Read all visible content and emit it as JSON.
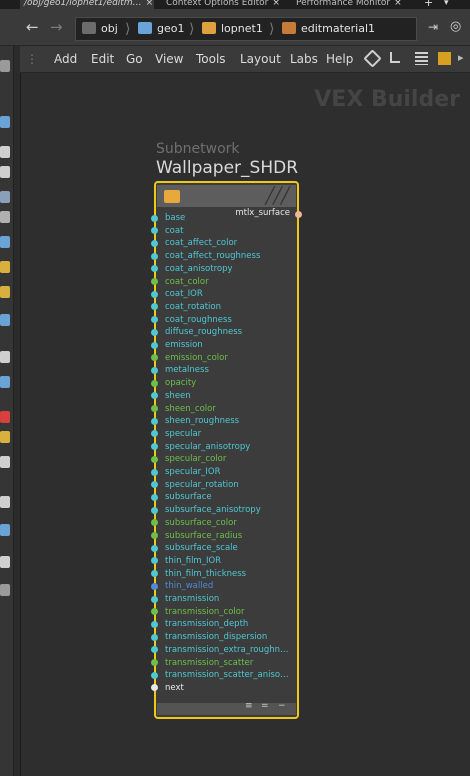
{
  "tabs": [
    {
      "label": "/obj/geo1/lopnet1/editm…",
      "active": true
    },
    {
      "label": "Context Options Editor",
      "active": false
    },
    {
      "label": "Performance Monitor",
      "active": false
    }
  ],
  "path": {
    "crumbs": [
      {
        "label": "obj",
        "color": "#555555"
      },
      {
        "label": "geo1",
        "color": "#6aa3d8"
      },
      {
        "label": "lopnet1",
        "color": "#e0a040"
      },
      {
        "label": "editmaterial1",
        "color": "#c77b3a"
      }
    ]
  },
  "menu": [
    "Add",
    "Edit",
    "Go",
    "View",
    "Tools",
    "Layout",
    "Labs",
    "Help"
  ],
  "context_label": "VEX Builder",
  "node": {
    "type": "Subnetwork",
    "name": "Wallpaper_SHDR",
    "output": "mtlx_surface",
    "output_color": "#f0b59a",
    "inputs": [
      {
        "label": "base",
        "color": "#4fc8d2"
      },
      {
        "label": "coat",
        "color": "#4fc8d2"
      },
      {
        "label": "coat_affect_color",
        "color": "#4fc8d2"
      },
      {
        "label": "coat_affect_roughness",
        "color": "#4fc8d2"
      },
      {
        "label": "coat_anisotropy",
        "color": "#4fc8d2"
      },
      {
        "label": "coat_color",
        "color": "#6dbf4a"
      },
      {
        "label": "coat_IOR",
        "color": "#4fc8d2"
      },
      {
        "label": "coat_rotation",
        "color": "#4fc8d2"
      },
      {
        "label": "coat_roughness",
        "color": "#4fc8d2"
      },
      {
        "label": "diffuse_roughness",
        "color": "#4fc8d2"
      },
      {
        "label": "emission",
        "color": "#4fc8d2"
      },
      {
        "label": "emission_color",
        "color": "#6dbf4a"
      },
      {
        "label": "metalness",
        "color": "#4fc8d2"
      },
      {
        "label": "opacity",
        "color": "#6dbf4a"
      },
      {
        "label": "sheen",
        "color": "#4fc8d2"
      },
      {
        "label": "sheen_color",
        "color": "#6dbf4a"
      },
      {
        "label": "sheen_roughness",
        "color": "#4fc8d2"
      },
      {
        "label": "specular",
        "color": "#4fc8d2"
      },
      {
        "label": "specular_anisotropy",
        "color": "#4fc8d2"
      },
      {
        "label": "specular_color",
        "color": "#6dbf4a"
      },
      {
        "label": "specular_IOR",
        "color": "#4fc8d2"
      },
      {
        "label": "specular_rotation",
        "color": "#4fc8d2"
      },
      {
        "label": "subsurface",
        "color": "#4fc8d2"
      },
      {
        "label": "subsurface_anisotropy",
        "color": "#4fc8d2"
      },
      {
        "label": "subsurface_color",
        "color": "#6dbf4a"
      },
      {
        "label": "subsurface_radius",
        "color": "#6dbf4a"
      },
      {
        "label": "subsurface_scale",
        "color": "#4fc8d2"
      },
      {
        "label": "thin_film_IOR",
        "color": "#4fc8d2"
      },
      {
        "label": "thin_film_thickness",
        "color": "#4fc8d2"
      },
      {
        "label": "thin_walled",
        "color": "#4f8ad8"
      },
      {
        "label": "transmission",
        "color": "#4fc8d2"
      },
      {
        "label": "transmission_color",
        "color": "#6dbf4a"
      },
      {
        "label": "transmission_depth",
        "color": "#4fc8d2"
      },
      {
        "label": "transmission_dispersion",
        "color": "#4fc8d2"
      },
      {
        "label": "transmission_extra_roughn…",
        "color": "#4fc8d2"
      },
      {
        "label": "transmission_scatter",
        "color": "#6dbf4a"
      },
      {
        "label": "transmission_scatter_aniso…",
        "color": "#4fc8d2"
      },
      {
        "label": "next",
        "color": "#e8e8e8"
      }
    ]
  }
}
